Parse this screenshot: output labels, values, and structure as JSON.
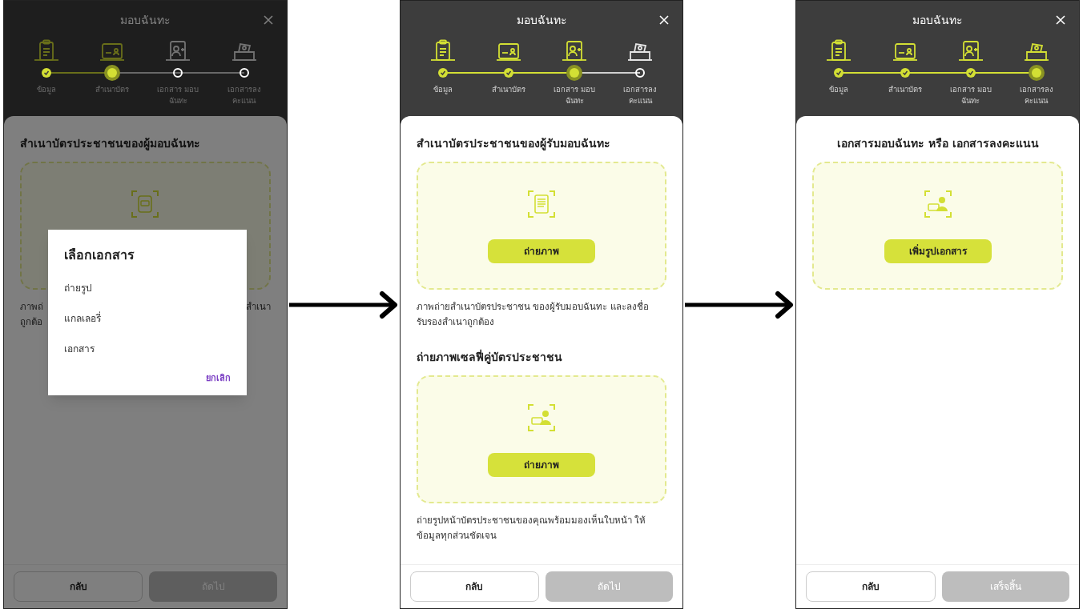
{
  "screens": [
    {
      "title": "มอบฉันทะ",
      "steps": [
        {
          "label": "ข้อมูล",
          "completed": true,
          "selected": false
        },
        {
          "label": "สำเนาบัตร",
          "completed": false,
          "selected": true
        },
        {
          "label": "เอกสาร มอบฉันทะ",
          "completed": false,
          "selected": false
        },
        {
          "label": "เอกสารลง คะแนน",
          "completed": false,
          "selected": false
        }
      ],
      "sections": [
        {
          "title": "สำเนาบัตรประชาชนของผู้มอบฉันทะ",
          "centered": false,
          "kind": "card",
          "note_lines": [
            [
              "ภาพถ่",
              "สำเนา"
            ],
            [
              "ถูกต้อ"
            ]
          ]
        }
      ],
      "dialog": {
        "title": "เลือกเอกสาร",
        "options": [
          "ถ่ายรูป",
          "แกลเลอรี่",
          "เอกสาร"
        ],
        "cancel": "ยกเลิก"
      },
      "footer": [
        {
          "label": "กลับ",
          "disabled": false
        },
        {
          "label": "ถัดไป",
          "disabled": true
        }
      ]
    },
    {
      "title": "มอบฉันทะ",
      "steps": [
        {
          "label": "ข้อมูล",
          "completed": true,
          "selected": false
        },
        {
          "label": "สำเนาบัตร",
          "completed": true,
          "selected": false
        },
        {
          "label": "เอกสาร มอบฉันทะ",
          "completed": false,
          "selected": true
        },
        {
          "label": "เอกสารลง คะแนน",
          "completed": false,
          "selected": false
        }
      ],
      "sections": [
        {
          "title": "สำเนาบัตรประชาชนของผู้รับมอบฉันทะ",
          "centered": false,
          "kind": "document",
          "button": "ถ่ายภาพ",
          "note": "ภาพถ่ายสำเนาบัตรประชาชน ของผู้รับมอบฉันทะ และลงชื่อรับรองสำเนาถูกต้อง"
        },
        {
          "title": "ถ่ายภาพเซลฟี่คู่บัตรประชาชน",
          "centered": false,
          "kind": "selfie",
          "button": "ถ่ายภาพ",
          "note": "ถ่ายรูปหน้าบัตรประชาชนของคุณพร้อมมองเห็นใบหน้า ให้ข้อมูลทุกส่วนชัดเจน"
        }
      ],
      "footer": [
        {
          "label": "กลับ",
          "disabled": false
        },
        {
          "label": "ถัดไป",
          "disabled": true
        }
      ]
    },
    {
      "title": "มอบฉันทะ",
      "steps": [
        {
          "label": "ข้อมูล",
          "completed": true,
          "selected": false
        },
        {
          "label": "สำเนาบัตร",
          "completed": true,
          "selected": false
        },
        {
          "label": "เอกสาร มอบฉันทะ",
          "completed": true,
          "selected": false
        },
        {
          "label": "เอกสารลง คะแนน",
          "completed": false,
          "selected": true
        }
      ],
      "sections": [
        {
          "title": "เอกสารมอบฉันทะ หรือ เอกสารลงคะแนน",
          "centered": true,
          "kind": "selfie",
          "button": "เพิ่มรูปเอกสาร"
        }
      ],
      "footer": [
        {
          "label": "กลับ",
          "disabled": false
        },
        {
          "label": "เสร็จสิ้น",
          "disabled": true
        }
      ]
    }
  ]
}
